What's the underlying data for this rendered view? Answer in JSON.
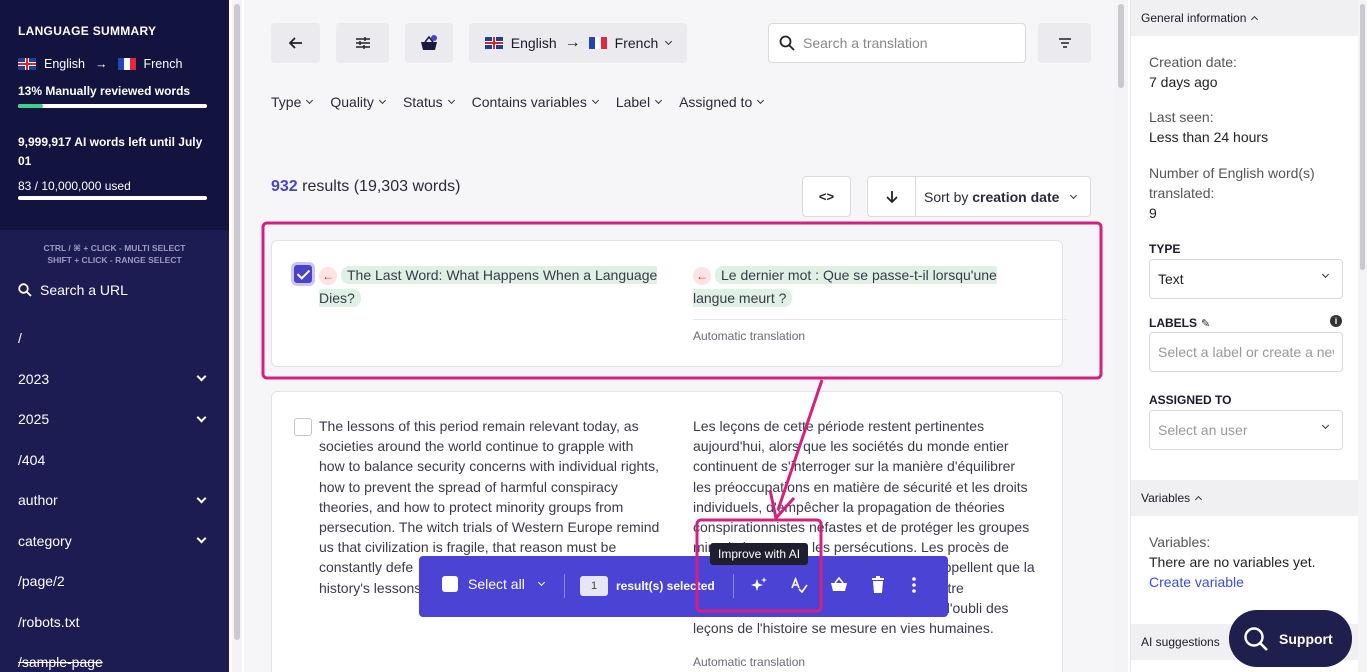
{
  "sidebar": {
    "summary_title": "LANGUAGE SUMMARY",
    "source_lang": "English",
    "target_lang": "French",
    "reviewed_label": "13% Manually reviewed words",
    "reviewed_percent": 13,
    "ai_words_left": "9,999,917 AI words left until July 01",
    "used_label": "83 / 10,000,000 used",
    "hint_line1": "CTRL / ⌘ + CLICK - MULTI SELECT",
    "hint_line2": "SHIFT + CLICK - RANGE SELECT",
    "search_url": "Search a URL",
    "nav": [
      {
        "label": "/",
        "expandable": false
      },
      {
        "label": "2023",
        "expandable": true
      },
      {
        "label": "2025",
        "expandable": true
      },
      {
        "label": "/404",
        "expandable": false
      },
      {
        "label": "author",
        "expandable": true
      },
      {
        "label": "category",
        "expandable": true
      },
      {
        "label": "/page/2",
        "expandable": false
      },
      {
        "label": "/robots.txt",
        "expandable": false
      },
      {
        "label": "/sample-page",
        "expandable": false,
        "strikethrough": true
      }
    ]
  },
  "toolbar": {
    "source_lang": "English",
    "target_lang": "French",
    "search_placeholder": "Search a translation"
  },
  "filters": [
    "Type",
    "Quality",
    "Status",
    "Contains variables",
    "Label",
    "Assigned to"
  ],
  "results": {
    "count": "932",
    "rest": "results (19,303 words)",
    "sort_prefix": "Sort by",
    "sort_field": "creation date"
  },
  "rows": [
    {
      "selected": true,
      "source": "The Last Word: What Happens When a Language Dies?",
      "target": "Le dernier mot : Que se passe-t-il lorsqu'une langue meurt ?",
      "status": "Automatic translation"
    },
    {
      "selected": false,
      "source_lines": [
        "The lessons of this period remain relevant today, as",
        "societies around the world continue to grapple with",
        "how to balance security concerns with individual rights,",
        "how to prevent the spread of harmful conspiracy",
        "theories, and how to protect minority groups from",
        "persecution. The witch trials of Western Europe remind",
        "us that civilization is fragile, that reason must be",
        "constantly defe",
        "history's lessons"
      ],
      "target_lines": [
        "Les leçons de cette période restent pertinentes",
        "aujourd'hui, alors que les sociétés du monde entier",
        "continuent de s'interroger sur la manière d'équilibrer",
        "les préoccupations en matière de sécurité et les droits",
        "individuels, d'empêcher la propagation de théories",
        "conspirationnistes néfastes et de protéger les groupes",
        "minoritaires contre les persécutions. Les procès de",
        "sorcières en Europe occidentale nous rappellent que la",
        "civilisation est fragile, que la raison doit être",
        "constamment défendue et que le prix de l'oubli des",
        "leçons de l'histoire se mesure en vies humaines."
      ],
      "status": "Automatic translation"
    }
  ],
  "bulk": {
    "select_all": "Select all",
    "selected_count": "1",
    "selected_label": "result(s) selected",
    "tooltip": "Improve with AI"
  },
  "right": {
    "general_title": "General information",
    "creation_label": "Creation date:",
    "creation_value": "7 days ago",
    "last_seen_label": "Last seen:",
    "last_seen_value": "Less than 24 hours",
    "words_label_1": "Number of English word(s)",
    "words_label_2": "translated:",
    "words_value": "9",
    "type_head": "TYPE",
    "type_value": "Text",
    "labels_head": "LABELS",
    "labels_placeholder": "Select a label or create a new one",
    "assigned_head": "ASSIGNED TO",
    "assigned_placeholder": "Select an user",
    "variables_title": "Variables",
    "variables_label": "Variables:",
    "variables_value": "There are no variables yet.",
    "create_variable": "Create variable",
    "ai_suggestions": "AI suggestions"
  },
  "support": "Support",
  "colors": {
    "accent": "#4a43c8",
    "sidebar": "#1c1c52",
    "annotation": "#d4217f"
  }
}
